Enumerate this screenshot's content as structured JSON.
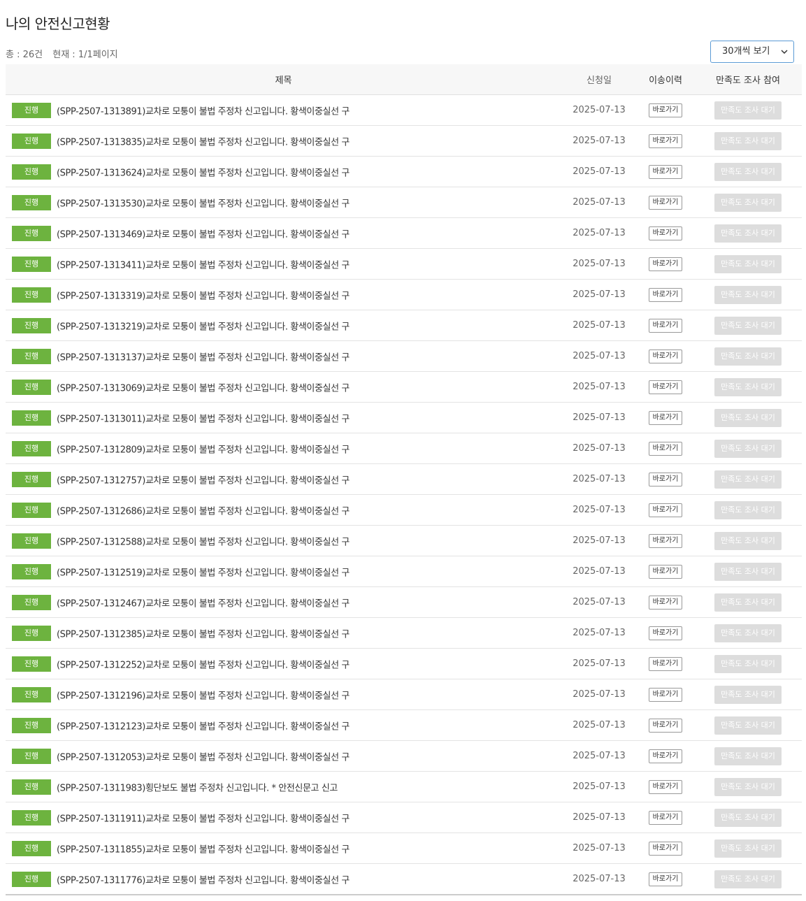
{
  "page": {
    "title": "나의 안전신고현황",
    "total": "총 : 26건",
    "current": "현재 : 1/1페이지",
    "page_size_option": "30개씩 보기"
  },
  "table": {
    "headers": {
      "title": "제목",
      "date": "신청일",
      "history": "이송이력",
      "survey": "만족도 조사 참여"
    },
    "rows": [
      {
        "status": "진행",
        "title": "(SPP-2507-1313891)교차로 모퉁이 불법 주정차 신고입니다. 황색이중실선 구",
        "date": "2025-07-13",
        "history": "바로가기",
        "survey": "만족도 조사 대기"
      },
      {
        "status": "진행",
        "title": "(SPP-2507-1313835)교차로 모퉁이 불법 주정차 신고입니다. 황색이중실선 구",
        "date": "2025-07-13",
        "history": "바로가기",
        "survey": "만족도 조사 대기"
      },
      {
        "status": "진행",
        "title": "(SPP-2507-1313624)교차로 모퉁이 불법 주정차 신고입니다. 황색이중실선 구",
        "date": "2025-07-13",
        "history": "바로가기",
        "survey": "만족도 조사 대기"
      },
      {
        "status": "진행",
        "title": "(SPP-2507-1313530)교차로 모퉁이 불법 주정차 신고입니다. 황색이중실선 구",
        "date": "2025-07-13",
        "history": "바로가기",
        "survey": "만족도 조사 대기"
      },
      {
        "status": "진행",
        "title": "(SPP-2507-1313469)교차로 모퉁이 불법 주정차 신고입니다. 황색이중실선 구",
        "date": "2025-07-13",
        "history": "바로가기",
        "survey": "만족도 조사 대기"
      },
      {
        "status": "진행",
        "title": "(SPP-2507-1313411)교차로 모퉁이 불법 주정차 신고입니다. 황색이중실선 구",
        "date": "2025-07-13",
        "history": "바로가기",
        "survey": "만족도 조사 대기"
      },
      {
        "status": "진행",
        "title": "(SPP-2507-1313319)교차로 모퉁이 불법 주정차 신고입니다. 황색이중실선 구",
        "date": "2025-07-13",
        "history": "바로가기",
        "survey": "만족도 조사 대기"
      },
      {
        "status": "진행",
        "title": "(SPP-2507-1313219)교차로 모퉁이 불법 주정차 신고입니다. 황색이중실선 구",
        "date": "2025-07-13",
        "history": "바로가기",
        "survey": "만족도 조사 대기"
      },
      {
        "status": "진행",
        "title": "(SPP-2507-1313137)교차로 모퉁이 불법 주정차 신고입니다. 황색이중실선 구",
        "date": "2025-07-13",
        "history": "바로가기",
        "survey": "만족도 조사 대기"
      },
      {
        "status": "진행",
        "title": "(SPP-2507-1313069)교차로 모퉁이 불법 주정차 신고입니다. 황색이중실선 구",
        "date": "2025-07-13",
        "history": "바로가기",
        "survey": "만족도 조사 대기"
      },
      {
        "status": "진행",
        "title": "(SPP-2507-1313011)교차로 모퉁이 불법 주정차 신고입니다. 황색이중실선 구",
        "date": "2025-07-13",
        "history": "바로가기",
        "survey": "만족도 조사 대기"
      },
      {
        "status": "진행",
        "title": "(SPP-2507-1312809)교차로 모퉁이 불법 주정차 신고입니다. 황색이중실선 구",
        "date": "2025-07-13",
        "history": "바로가기",
        "survey": "만족도 조사 대기"
      },
      {
        "status": "진행",
        "title": "(SPP-2507-1312757)교차로 모퉁이 불법 주정차 신고입니다. 황색이중실선 구",
        "date": "2025-07-13",
        "history": "바로가기",
        "survey": "만족도 조사 대기"
      },
      {
        "status": "진행",
        "title": "(SPP-2507-1312686)교차로 모퉁이 불법 주정차 신고입니다. 황색이중실선 구",
        "date": "2025-07-13",
        "history": "바로가기",
        "survey": "만족도 조사 대기"
      },
      {
        "status": "진행",
        "title": "(SPP-2507-1312588)교차로 모퉁이 불법 주정차 신고입니다. 황색이중실선 구",
        "date": "2025-07-13",
        "history": "바로가기",
        "survey": "만족도 조사 대기"
      },
      {
        "status": "진행",
        "title": "(SPP-2507-1312519)교차로 모퉁이 불법 주정차 신고입니다. 황색이중실선 구",
        "date": "2025-07-13",
        "history": "바로가기",
        "survey": "만족도 조사 대기"
      },
      {
        "status": "진행",
        "title": "(SPP-2507-1312467)교차로 모퉁이 불법 주정차 신고입니다. 황색이중실선 구",
        "date": "2025-07-13",
        "history": "바로가기",
        "survey": "만족도 조사 대기"
      },
      {
        "status": "진행",
        "title": "(SPP-2507-1312385)교차로 모퉁이 불법 주정차 신고입니다. 황색이중실선 구",
        "date": "2025-07-13",
        "history": "바로가기",
        "survey": "만족도 조사 대기"
      },
      {
        "status": "진행",
        "title": "(SPP-2507-1312252)교차로 모퉁이 불법 주정차 신고입니다. 황색이중실선 구",
        "date": "2025-07-13",
        "history": "바로가기",
        "survey": "만족도 조사 대기"
      },
      {
        "status": "진행",
        "title": "(SPP-2507-1312196)교차로 모퉁이 불법 주정차 신고입니다. 황색이중실선 구",
        "date": "2025-07-13",
        "history": "바로가기",
        "survey": "만족도 조사 대기"
      },
      {
        "status": "진행",
        "title": "(SPP-2507-1312123)교차로 모퉁이 불법 주정차 신고입니다. 황색이중실선 구",
        "date": "2025-07-13",
        "history": "바로가기",
        "survey": "만족도 조사 대기"
      },
      {
        "status": "진행",
        "title": "(SPP-2507-1312053)교차로 모퉁이 불법 주정차 신고입니다. 황색이중실선 구",
        "date": "2025-07-13",
        "history": "바로가기",
        "survey": "만족도 조사 대기"
      },
      {
        "status": "진행",
        "title": "(SPP-2507-1311983)횡단보도 불법 주정차 신고입니다. * 안전신문고 신고",
        "date": "2025-07-13",
        "history": "바로가기",
        "survey": "만족도 조사 대기"
      },
      {
        "status": "진행",
        "title": "(SPP-2507-1311911)교차로 모퉁이 불법 주정차 신고입니다. 황색이중실선 구",
        "date": "2025-07-13",
        "history": "바로가기",
        "survey": "만족도 조사 대기"
      },
      {
        "status": "진행",
        "title": "(SPP-2507-1311855)교차로 모퉁이 불법 주정차 신고입니다. 황색이중실선 구",
        "date": "2025-07-13",
        "history": "바로가기",
        "survey": "만족도 조사 대기"
      },
      {
        "status": "진행",
        "title": "(SPP-2507-1311776)교차로 모퉁이 불법 주정차 신고입니다. 황색이중실선 구",
        "date": "2025-07-13",
        "history": "바로가기",
        "survey": "만족도 조사 대기"
      }
    ]
  },
  "colors": {
    "status_badge": "#6db33f",
    "survey_disabled": "#dddddd",
    "select_border": "#5b9bd5"
  },
  "icons": {
    "select_arrow": "chevron-down-icon"
  }
}
